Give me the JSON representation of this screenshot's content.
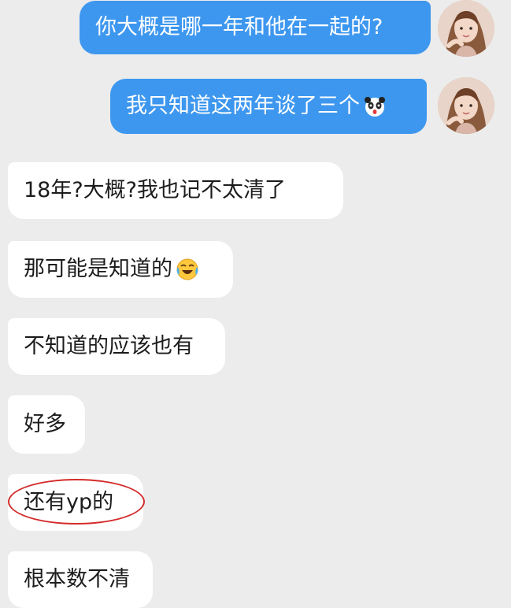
{
  "messages": [
    {
      "side": "out",
      "text": "你大概是哪一年和他在一起的?"
    },
    {
      "side": "out",
      "text": "我只知道这两年谈了三个",
      "emoji": "shocked-panda-emoji"
    },
    {
      "side": "in",
      "text": "18年?大概?我也记不太清了"
    },
    {
      "side": "in",
      "text": "那可能是知道的",
      "emoji": "crying-laughing-emoji"
    },
    {
      "side": "in",
      "text": "不知道的应该也有"
    },
    {
      "side": "in",
      "text": "好多"
    },
    {
      "side": "in",
      "text": "还有yp的",
      "highlighted": true
    },
    {
      "side": "in",
      "text": "根本数不清"
    }
  ],
  "colors": {
    "background": "#ececec",
    "outgoing_bubble": "#3d97ef",
    "incoming_bubble": "#ffffff",
    "highlight_ring": "#d42b2b"
  },
  "icons": {
    "avatar": "user-avatar-photo",
    "annotation": "red-ellipse-annotation"
  }
}
